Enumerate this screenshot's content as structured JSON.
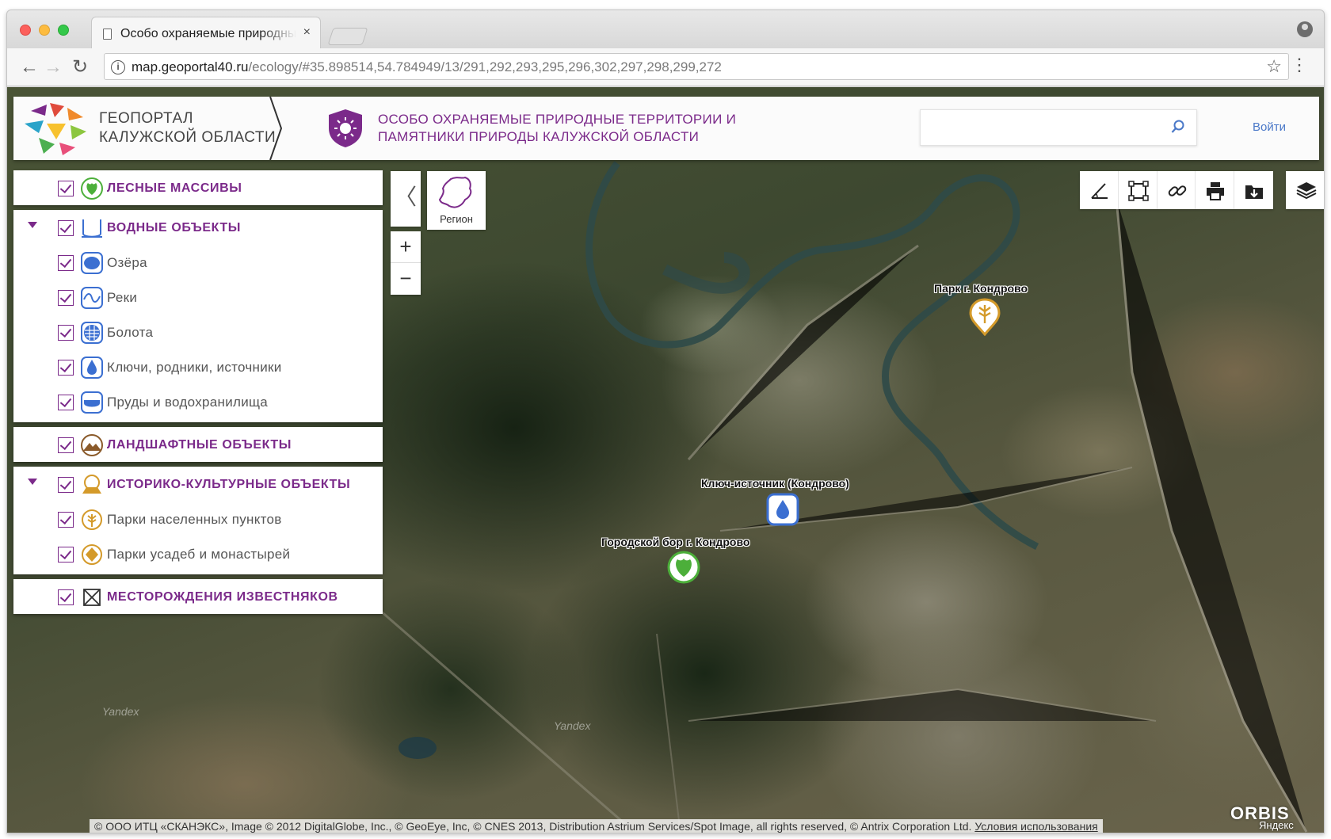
{
  "browser": {
    "tab_title": "Особо охраняемые природные",
    "tab_close": "×",
    "url_host": "map.geoportal40.ru",
    "url_path": "/ecology/#35.898514,54.784949/13/291,292,293,295,296,302,297,298,299,272"
  },
  "header": {
    "brand_line1": "ГЕОПОРТАЛ",
    "brand_line2": "КАЛУЖСКОЙ ОБЛАСТИ",
    "section_line1": "ОСОБО ОХРАНЯЕМЫЕ ПРИРОДНЫЕ ТЕРРИТОРИИ И",
    "section_line2": "ПАМЯТНИКИ ПРИРОДЫ КАЛУЖСКОЙ ОБЛАСТИ",
    "search_placeholder": "",
    "login_label": "Войти"
  },
  "layers": {
    "forest": {
      "label": "Лесные массивы",
      "checked": true
    },
    "water": {
      "label": "Водные объекты",
      "checked": true,
      "items": [
        {
          "label": "Озёра",
          "checked": true
        },
        {
          "label": "Реки",
          "checked": true
        },
        {
          "label": "Болота",
          "checked": true
        },
        {
          "label": "Ключи, родники, источники",
          "checked": true
        },
        {
          "label": "Пруды и водохранилища",
          "checked": true
        }
      ]
    },
    "landscape": {
      "label": "Ландшафтные объекты",
      "checked": true
    },
    "heritage": {
      "label": "Историко-культурные объекты",
      "checked": true,
      "items": [
        {
          "label": "Парки населенных пунктов",
          "checked": true
        },
        {
          "label": "Парки усадеб и монастырей",
          "checked": true
        }
      ]
    },
    "limestone": {
      "label": "Месторождения известняков",
      "checked": true
    }
  },
  "controls": {
    "collapse": "〈",
    "region_label": "Регион",
    "zoom_in": "+",
    "zoom_out": "−"
  },
  "markers": [
    {
      "label": "Парк г. Кондрово",
      "kind": "park"
    },
    {
      "label": "Ключ-источник (Кондрово)",
      "kind": "spring"
    },
    {
      "label": "Городской бор г. Кондрово",
      "kind": "forest"
    }
  ],
  "map": {
    "watermark": "Yandex",
    "attribution": "© ООО ИТЦ «СКАНЭКС», Image © 2012 DigitalGlobe, Inc., © GeoEye, Inc, © CNES 2013, Distribution Astrium Services/Spot Image, all rights reserved, © Antrix Corporation Ltd.",
    "terms_link": "Условия использования",
    "orbis": "ORBIS",
    "yandex_logo": "Яндекс"
  },
  "colors": {
    "accent": "#7b2a8a",
    "water": "#3b6fd1",
    "forest": "#4caf3a",
    "heritage": "#d49a2a",
    "link": "#4a78c8"
  }
}
